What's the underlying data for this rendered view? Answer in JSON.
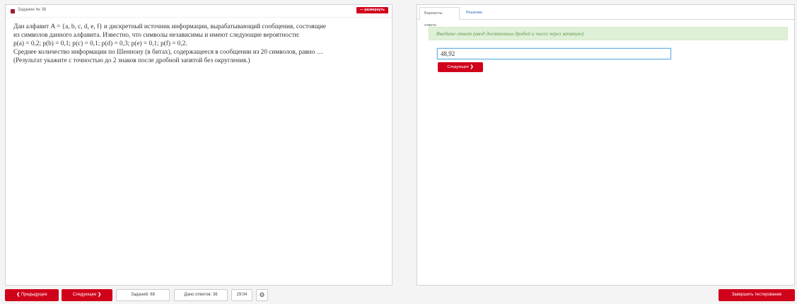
{
  "task": {
    "title": "Задание № 36",
    "collapse_label": "— развернуть",
    "lines": [
      "Дан алфавит A = {a, b, c, d, e, f} и дискретный источник информации, вырабатывающий сообщения, состоящие",
      "из символов данного алфавита. Известно, что символы независимы и имеют следующие вероятности:",
      "p(a) = 0,2; p(b) = 0,1; p(c) = 0,1; p(d) = 0,3; p(e) = 0,1; p(f) = 0,2.",
      "Среднее количество информации по Шеннону (в битах), содержащееся в сообщении из 20 символов, равно …",
      "(Результат укажите с точностью до 2 знаков после дробной запятой без округления.)"
    ]
  },
  "answer": {
    "tabs": [
      "Варианты ответа",
      "Решение"
    ],
    "hint": "Введите ответ (ввод десятичных дробей и чисел через запятую)",
    "input_value": "48,92",
    "next_label": "Следующее"
  },
  "footer": {
    "prev_label": "Предыдущее",
    "next_label": "Следующее",
    "tasks_count": "Заданий: 68",
    "answered_count": "Дано ответов: 36",
    "timer": "29:04",
    "finish_label": "Завершить тестирование"
  }
}
